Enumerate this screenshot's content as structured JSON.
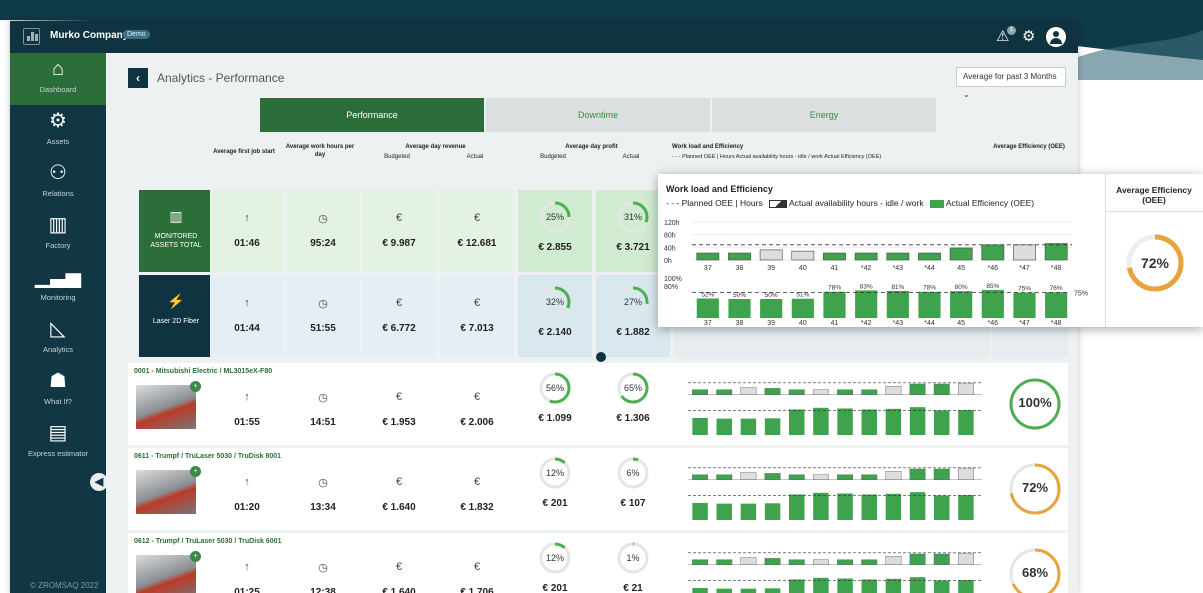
{
  "header": {
    "company": "Murko Company",
    "badge": "Demo",
    "notif_count": "1"
  },
  "sidebar": {
    "items": [
      {
        "label": "Dashboard",
        "icon": "home-icon"
      },
      {
        "label": "Assets",
        "icon": "assets-icon"
      },
      {
        "label": "Relations",
        "icon": "relations-icon"
      },
      {
        "label": "Factory",
        "icon": "factory-icon"
      },
      {
        "label": "Monitoring",
        "icon": "monitoring-icon"
      },
      {
        "label": "Analytics",
        "icon": "analytics-icon"
      },
      {
        "label": "What If?",
        "icon": "whatif-icon"
      },
      {
        "label": "Express estimator",
        "icon": "estimator-icon"
      }
    ],
    "copyright": "© ZROMSAQ 2022"
  },
  "page": {
    "title": "Analytics - Performance",
    "period": "Average for past 3 Months"
  },
  "tabs": [
    "Performance",
    "Downtime",
    "Energy"
  ],
  "table_header": {
    "first_job": "Average first job start",
    "work_hours": "Average work hours per day",
    "revenue": "Average day revenue",
    "revenue_budget": "Budgeted",
    "revenue_actual": "Actual",
    "profit": "Average day profit",
    "profit_budget": "Budgeted",
    "profit_actual": "Actual",
    "workload": "Work load and Efficiency",
    "workload_legend": "- - - Planned OEE | Hours   Actual availability hours - idle / work   Actual Efficiency (OEE)",
    "oee": "Average Efficiency (OEE)"
  },
  "summary": [
    {
      "label": "MONITORED ASSETS TOTAL",
      "first_job": "01:46",
      "work_hours": "95:24",
      "rev_budget": "€ 9.987",
      "rev_actual": "€ 12.681",
      "profit_budget": "€ 2.855",
      "profit_actual": "€ 3.721",
      "profit_budget_pct": "25%",
      "profit_actual_pct": "31%",
      "p1": 25,
      "p2": 31
    },
    {
      "label": "Laser 2D Fiber",
      "first_job": "01:44",
      "work_hours": "51:55",
      "rev_budget": "€ 6.772",
      "rev_actual": "€ 7.013",
      "profit_budget": "€ 2.140",
      "profit_actual": "€ 1.882",
      "profit_budget_pct": "32%",
      "profit_actual_pct": "27%",
      "p1": 32,
      "p2": 27
    }
  ],
  "assets": [
    {
      "name": "0001 - Mitsubishi Electric / ML3015eX-F80",
      "first_job": "01:55",
      "work_hours": "14:51",
      "rev_budget": "€ 1.953",
      "rev_actual": "€ 2.006",
      "profit_budget": "€ 1.099",
      "profit_actual": "€ 1.306",
      "profit_budget_pct": "56%",
      "profit_actual_pct": "65%",
      "p1": 56,
      "p2": 65,
      "oee": "100%",
      "oee_val": 100
    },
    {
      "name": "0611 - Trumpf / TruLaser 5030 / TruDisk 8001",
      "first_job": "01:20",
      "work_hours": "13:34",
      "rev_budget": "€ 1.640",
      "rev_actual": "€ 1.832",
      "profit_budget": "€ 201",
      "profit_actual": "€ 107",
      "profit_budget_pct": "12%",
      "profit_actual_pct": "6%",
      "p1": 12,
      "p2": 6,
      "oee": "72%",
      "oee_val": 72
    },
    {
      "name": "0612 - Trumpf / TruLaser 5030 / TruDisk 6001",
      "first_job": "01:25",
      "work_hours": "12:38",
      "rev_budget": "€ 1.640",
      "rev_actual": "€ 1.706",
      "profit_budget": "€ 201",
      "profit_actual": "€ 21",
      "profit_budget_pct": "12%",
      "profit_actual_pct": "1%",
      "p1": 12,
      "p2": 1,
      "oee": "68%",
      "oee_val": 68
    }
  ],
  "popup": {
    "title": "Work load and Efficiency",
    "legend_planned": "- - - Planned OEE | Hours",
    "legend_avail": "Actual availability hours - idle / work",
    "legend_oee": "Actual Efficiency (OEE)",
    "oee_header": "Average Efficiency (OEE)",
    "oee": "72%",
    "oee_val": 72
  },
  "chart_data": {
    "type": "bar",
    "title": "Work load and Efficiency",
    "categories": [
      "37",
      "38",
      "39",
      "40",
      "41",
      "*42",
      "*43",
      "*44",
      "45",
      "*46",
      "*47",
      "*48"
    ],
    "hours_ticks": [
      "120h",
      "80h",
      "40h",
      "0h"
    ],
    "pct_ticks": [
      "100%",
      "80%"
    ],
    "planned_oee_label": "75%",
    "series": [
      {
        "name": "Actual availability hours - idle / work",
        "values": [
          22,
          22,
          32,
          28,
          22,
          22,
          22,
          22,
          38,
          48,
          48,
          52
        ],
        "ylim": [
          0,
          120
        ]
      },
      {
        "name": "Actual Efficiency (OEE)",
        "values": [
          52,
          50,
          50,
          51,
          78,
          83,
          81,
          78,
          80,
          85,
          75,
          76
        ],
        "ylim": [
          0,
          100
        ]
      }
    ],
    "pct_labels": [
      "52%",
      "50%",
      "50%",
      "51%",
      "78%",
      "83%",
      "81%",
      "78%",
      "80%",
      "85%",
      "75%",
      "76%"
    ]
  },
  "colors": {
    "dark": "#0f3340",
    "green": "#2c6e3a",
    "bar_green": "#3fa34d",
    "ring_green": "#4caf50",
    "ring_orange": "#e8a33d"
  }
}
